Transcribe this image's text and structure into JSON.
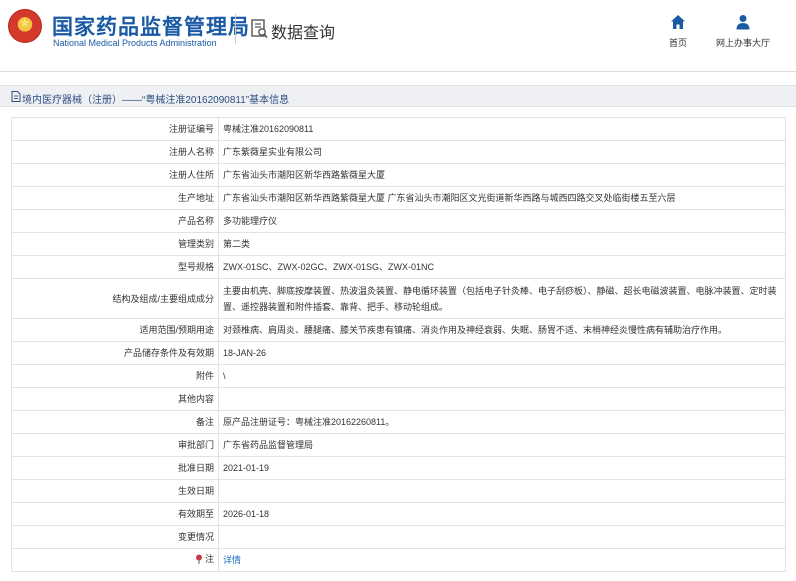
{
  "header": {
    "logo_cn": "国家药品监督管理局",
    "logo_en": "National Medical Products Administration",
    "query_title": "数据查询",
    "nav": [
      {
        "label": "首页",
        "icon": "home-icon"
      },
      {
        "label": "网上办事大厅",
        "icon": "user-icon"
      }
    ]
  },
  "breadcrumb": {
    "text": "境内医疗器械（注册）——“粤械注准20162090811”基本信息"
  },
  "rows": [
    {
      "label": "注册证编号",
      "value": "粤械注准20162090811"
    },
    {
      "label": "注册人名称",
      "value": "广东紫薇星实业有限公司"
    },
    {
      "label": "注册人住所",
      "value": "广东省汕头市潮阳区新华西路紫薇星大厦"
    },
    {
      "label": "生产地址",
      "value": "广东省汕头市潮阳区新华西路紫薇星大厦 广东省汕头市潮阳区文光街道新华西路与城西四路交叉处临街楼五至六层"
    },
    {
      "label": "产品名称",
      "value": "多功能理疗仪"
    },
    {
      "label": "管理类别",
      "value": "第二类"
    },
    {
      "label": "型号规格",
      "value": "ZWX-01SC、ZWX-02GC、ZWX-01SG、ZWX-01NC"
    },
    {
      "label": "结构及组成/主要组成成分",
      "value": "主要由机壳、脚底按摩装置、热波温灸装置、静电循环装置（包括电子针灸棒、电子刮痧板）、静磁、超长电磁波装置、电脉冲装置、定时装置、遥控器装置和附件插套、靠背、把手、移动轮组成。"
    },
    {
      "label": "适用范围/预期用途",
      "value": "对颈椎病、肩周炎、腰腿痛、膝关节疾患有镇痛、消炎作用及神经衰弱、失眠、肠胃不适、末梢神经炎慢性病有辅助治疗作用。"
    },
    {
      "label": "产品储存条件及有效期",
      "value": "18-JAN-26"
    },
    {
      "label": "附件",
      "value": "\\"
    },
    {
      "label": "其他内容",
      "value": ""
    },
    {
      "label": "备注",
      "value": "原产品注册证号：粤械注准20162260811。"
    },
    {
      "label": "审批部门",
      "value": "广东省药品监督管理局"
    },
    {
      "label": "批准日期",
      "value": "2021-01-19"
    },
    {
      "label": "生效日期",
      "value": ""
    },
    {
      "label": "有效期至",
      "value": "2026-01-18"
    },
    {
      "label": "变更情况",
      "value": ""
    },
    {
      "label": "注",
      "value": "详情"
    }
  ],
  "colors": {
    "brand_blue": "#1a5aa5",
    "link": "#1a6ec2",
    "emblem_red": "#d33a2c"
  }
}
